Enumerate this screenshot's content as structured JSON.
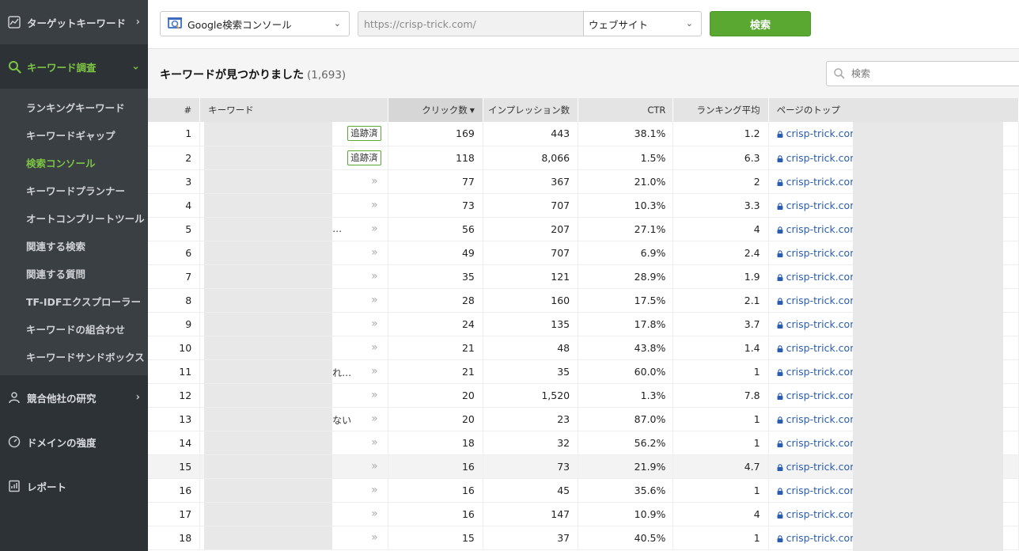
{
  "sidebar": {
    "sections": [
      {
        "label": "ターゲットキーワード",
        "icon": "chart-icon"
      },
      {
        "label": "キーワード調査",
        "icon": "search-icon"
      },
      {
        "label": "競合他社の研究",
        "icon": "person-icon"
      },
      {
        "label": "ドメインの強度",
        "icon": "gauge-icon"
      },
      {
        "label": "レポート",
        "icon": "report-icon"
      }
    ],
    "sub_items": [
      "ランキングキーワード",
      "キーワードギャップ",
      "検索コンソール",
      "キーワードプランナー",
      "オートコンプリートツール",
      "関連する検索",
      "関連する質問",
      "TF-IDFエクスプローラー",
      "キーワードの組合わせ",
      "キーワードサンドボックス"
    ],
    "active_sub_index": 2,
    "accent_color": "#7cc443"
  },
  "topbar": {
    "source_label": "Google検索コンソール",
    "url_value": "https://crisp-trick.com/",
    "scope_label": "ウェブサイト",
    "search_button": "検索",
    "button_color": "#5aa832"
  },
  "results": {
    "title": "キーワードが見つかりました",
    "count": "(1,693)",
    "filter_placeholder": "検索"
  },
  "table": {
    "headers": {
      "num": "#",
      "keyword": "キーワード",
      "clicks": "クリック数",
      "impressions": "インプレッション数",
      "ctr": "CTR",
      "rank": "ランキング平均",
      "page": "ページのトップ"
    },
    "rows": [
      {
        "n": "1",
        "frag": "",
        "tag": "追跡済",
        "clicks": "169",
        "imp": "443",
        "ctr": "38.1%",
        "rank": "1.2",
        "page": "crisp-trick.com/"
      },
      {
        "n": "2",
        "frag": "",
        "tag": "追跡済",
        "clicks": "118",
        "imp": "8,066",
        "ctr": "1.5%",
        "rank": "6.3",
        "page": "crisp-trick.com/"
      },
      {
        "n": "3",
        "frag": "",
        "tag": "",
        "clicks": "77",
        "imp": "367",
        "ctr": "21.0%",
        "rank": "2",
        "page": "crisp-trick.com/"
      },
      {
        "n": "4",
        "frag": "",
        "tag": "",
        "clicks": "73",
        "imp": "707",
        "ctr": "10.3%",
        "rank": "3.3",
        "page": "crisp-trick.com/"
      },
      {
        "n": "5",
        "frag": "…",
        "tag": "",
        "clicks": "56",
        "imp": "207",
        "ctr": "27.1%",
        "rank": "4",
        "page": "crisp-trick.com/"
      },
      {
        "n": "6",
        "frag": "",
        "tag": "",
        "clicks": "49",
        "imp": "707",
        "ctr": "6.9%",
        "rank": "2.4",
        "page": "crisp-trick.com/"
      },
      {
        "n": "7",
        "frag": "",
        "tag": "",
        "clicks": "35",
        "imp": "121",
        "ctr": "28.9%",
        "rank": "1.9",
        "page": "crisp-trick.com/"
      },
      {
        "n": "8",
        "frag": "",
        "tag": "",
        "clicks": "28",
        "imp": "160",
        "ctr": "17.5%",
        "rank": "2.1",
        "page": "crisp-trick.com/"
      },
      {
        "n": "9",
        "frag": "",
        "tag": "",
        "clicks": "24",
        "imp": "135",
        "ctr": "17.8%",
        "rank": "3.7",
        "page": "crisp-trick.com/"
      },
      {
        "n": "10",
        "frag": "",
        "tag": "",
        "clicks": "21",
        "imp": "48",
        "ctr": "43.8%",
        "rank": "1.4",
        "page": "crisp-trick.com/"
      },
      {
        "n": "11",
        "frag": "れ…",
        "tag": "",
        "clicks": "21",
        "imp": "35",
        "ctr": "60.0%",
        "rank": "1",
        "page": "crisp-trick.com/"
      },
      {
        "n": "12",
        "frag": "",
        "tag": "",
        "clicks": "20",
        "imp": "1,520",
        "ctr": "1.3%",
        "rank": "7.8",
        "page": "crisp-trick.com/"
      },
      {
        "n": "13",
        "frag": "ない",
        "tag": "",
        "clicks": "20",
        "imp": "23",
        "ctr": "87.0%",
        "rank": "1",
        "page": "crisp-trick.com/"
      },
      {
        "n": "14",
        "frag": "",
        "tag": "",
        "clicks": "18",
        "imp": "32",
        "ctr": "56.2%",
        "rank": "1",
        "page": "crisp-trick.com/"
      },
      {
        "n": "15",
        "frag": "",
        "tag": "",
        "clicks": "16",
        "imp": "73",
        "ctr": "21.9%",
        "rank": "4.7",
        "page": "crisp-trick.com/"
      },
      {
        "n": "16",
        "frag": "",
        "tag": "",
        "clicks": "16",
        "imp": "45",
        "ctr": "35.6%",
        "rank": "1",
        "page": "crisp-trick.com/"
      },
      {
        "n": "17",
        "frag": "",
        "tag": "",
        "clicks": "16",
        "imp": "147",
        "ctr": "10.9%",
        "rank": "4",
        "page": "crisp-trick.com/"
      },
      {
        "n": "18",
        "frag": "",
        "tag": "",
        "clicks": "15",
        "imp": "37",
        "ctr": "40.5%",
        "rank": "1",
        "page": "crisp-trick.com/"
      }
    ],
    "highlighted_row_index": 14
  }
}
